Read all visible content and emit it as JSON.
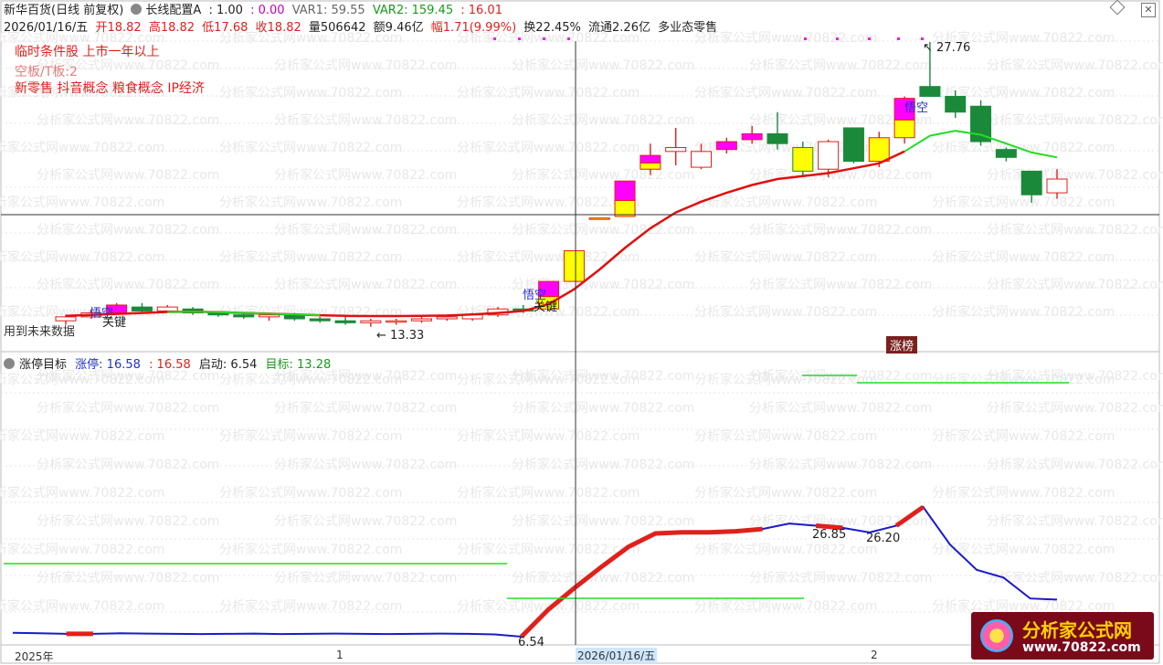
{
  "header": {
    "stock": "新华百货(日线 前复权)",
    "indicator": "长线配置A",
    "ind_val1": ": 1.00",
    "ind_val2": ": 0.00",
    "var1": "VAR1: 59.55",
    "var2": "VAR2: 159.45",
    "var3": ": 16.01",
    "date": "2026/01/16/五",
    "open": "开18.82",
    "high": "高18.82",
    "low": "低17.68",
    "close": "收18.82",
    "volume": "量506642",
    "amount": "额9.46亿",
    "change": "幅1.71(9.99%)",
    "turnover": "换22.45%",
    "float": "流通2.26亿",
    "sector": "多业态零售"
  },
  "notes": {
    "line1": "临时条件股 上市一年以上",
    "line2": "空板/T板:2",
    "line3": "新零售 抖音概念 粮食概念 IP经济"
  },
  "labels": {
    "future_data": "用到未来数据",
    "limit_list": "涨榜",
    "low_price": "13.33",
    "high_price": "27.76",
    "wukong": "悟空",
    "key": "关键"
  },
  "indicator_panel": {
    "title": "涨停目标",
    "zt_label": "涨停: 16.58",
    "zt_val": ": 16.58",
    "start_label": "启动: 6.54",
    "target_label": "目标: 13.28",
    "annot_1": "26.85",
    "annot_2": "26.20",
    "annot_3": "6.54"
  },
  "xaxis": {
    "year": "2025年",
    "m1": "1",
    "cursor_date": "2026/01/16/五",
    "m2": "2"
  },
  "watermark": "分析家公式网www.70822.com",
  "logo": {
    "title": "分析家公式网",
    "url": "www.70822.com"
  },
  "colors": {
    "up": "#e0201b",
    "down": "#1a8a3a",
    "magenta": "#ff00ff",
    "yellow": "#ffff00",
    "ma": "#e01010",
    "ma_green": "#22dd22",
    "blue_line": "#1a1acc"
  },
  "chart_data": [
    {
      "type": "candlestick",
      "candles": [
        {
          "o": 13.6,
          "h": 13.9,
          "l": 13.4,
          "c": 13.8,
          "mark": "normal"
        },
        {
          "o": 13.8,
          "h": 14.1,
          "l": 13.7,
          "c": 14.0,
          "mark": "normal"
        },
        {
          "o": 14.0,
          "h": 14.5,
          "l": 13.9,
          "c": 14.4,
          "mark": "magenta"
        },
        {
          "o": 14.3,
          "h": 14.5,
          "l": 14.0,
          "c": 14.1,
          "mark": "normal"
        },
        {
          "o": 14.1,
          "h": 14.4,
          "l": 14.0,
          "c": 14.3,
          "mark": "normal"
        },
        {
          "o": 14.2,
          "h": 14.3,
          "l": 13.9,
          "c": 14.0,
          "mark": "normal"
        },
        {
          "o": 14.0,
          "h": 14.1,
          "l": 13.8,
          "c": 13.9,
          "mark": "normal"
        },
        {
          "o": 13.9,
          "h": 14.0,
          "l": 13.7,
          "c": 13.8,
          "mark": "normal"
        },
        {
          "o": 13.8,
          "h": 14.0,
          "l": 13.6,
          "c": 13.9,
          "mark": "normal"
        },
        {
          "o": 13.9,
          "h": 14.0,
          "l": 13.6,
          "c": 13.7,
          "mark": "normal"
        },
        {
          "o": 13.7,
          "h": 13.8,
          "l": 13.5,
          "c": 13.6,
          "mark": "normal"
        },
        {
          "o": 13.6,
          "h": 13.8,
          "l": 13.4,
          "c": 13.5,
          "mark": "normal"
        },
        {
          "o": 13.5,
          "h": 13.7,
          "l": 13.3,
          "c": 13.6,
          "mark": "normal"
        },
        {
          "o": 13.6,
          "h": 13.7,
          "l": 13.4,
          "c": 13.6,
          "mark": "normal"
        },
        {
          "o": 13.6,
          "h": 13.8,
          "l": 13.5,
          "c": 13.7,
          "mark": "normal"
        },
        {
          "o": 13.7,
          "h": 13.9,
          "l": 13.6,
          "c": 13.8,
          "mark": "normal"
        },
        {
          "o": 13.7,
          "h": 14.0,
          "l": 13.6,
          "c": 13.9,
          "mark": "normal"
        },
        {
          "o": 13.9,
          "h": 14.3,
          "l": 13.8,
          "c": 14.2,
          "mark": "normal"
        },
        {
          "o": 14.2,
          "h": 14.4,
          "l": 14.0,
          "c": 14.1,
          "mark": "normal"
        },
        {
          "o": 14.2,
          "h": 15.6,
          "l": 14.2,
          "c": 15.6,
          "mark": "magenta"
        },
        {
          "o": 15.6,
          "h": 17.16,
          "l": 15.6,
          "c": 17.16,
          "mark": "yellow"
        },
        {
          "o": 18.8,
          "h": 18.82,
          "l": 18.8,
          "c": 18.82,
          "mark": "yellow"
        },
        {
          "o": 18.9,
          "h": 20.7,
          "l": 18.9,
          "c": 20.7,
          "mark": "magenta"
        },
        {
          "o": 21.3,
          "h": 22.6,
          "l": 21.0,
          "c": 22.0,
          "mark": "magenta"
        },
        {
          "o": 22.2,
          "h": 23.4,
          "l": 21.5,
          "c": 22.4,
          "mark": "normal"
        },
        {
          "o": 21.4,
          "h": 22.6,
          "l": 21.3,
          "c": 22.2,
          "mark": "normal"
        },
        {
          "o": 22.3,
          "h": 22.9,
          "l": 22.1,
          "c": 22.7,
          "mark": "magenta"
        },
        {
          "o": 22.8,
          "h": 23.5,
          "l": 22.6,
          "c": 23.1,
          "mark": "magenta"
        },
        {
          "o": 23.1,
          "h": 24.2,
          "l": 22.3,
          "c": 22.6,
          "mark": "normal"
        },
        {
          "o": 22.4,
          "h": 22.7,
          "l": 20.9,
          "c": 21.2,
          "mark": "yellow"
        },
        {
          "o": 21.3,
          "h": 22.8,
          "l": 20.9,
          "c": 22.7,
          "mark": "normal"
        },
        {
          "o": 23.4,
          "h": 23.4,
          "l": 21.6,
          "c": 21.7,
          "mark": "normal"
        },
        {
          "o": 21.7,
          "h": 23.2,
          "l": 21.4,
          "c": 22.9,
          "mark": "yellow"
        },
        {
          "o": 22.9,
          "h": 25.0,
          "l": 22.6,
          "c": 24.9,
          "mark": "magenta"
        },
        {
          "o": 25.5,
          "h": 27.76,
          "l": 25.0,
          "c": 25.0,
          "mark": "normal"
        },
        {
          "o": 25.0,
          "h": 25.3,
          "l": 23.9,
          "c": 24.2,
          "mark": "normal"
        },
        {
          "o": 24.5,
          "h": 24.8,
          "l": 22.5,
          "c": 22.7,
          "mark": "normal"
        },
        {
          "o": 22.3,
          "h": 22.4,
          "l": 21.7,
          "c": 21.9,
          "mark": "normal"
        },
        {
          "o": 21.2,
          "h": 21.2,
          "l": 19.6,
          "c": 20.0,
          "mark": "normal"
        },
        {
          "o": 20.1,
          "h": 21.3,
          "l": 19.8,
          "c": 20.8,
          "mark": "normal"
        }
      ],
      "ma": [
        13.85,
        13.9,
        13.95,
        14.0,
        14.05,
        14.06,
        14.04,
        14.0,
        13.96,
        13.92,
        13.88,
        13.85,
        13.84,
        13.84,
        13.85,
        13.87,
        13.92,
        14.0,
        14.1,
        14.45,
        15.2,
        16.2,
        17.3,
        18.3,
        19.1,
        19.65,
        20.1,
        20.5,
        20.8,
        20.95,
        21.1,
        21.35,
        21.6,
        22.2,
        23.0,
        23.25,
        23.05,
        22.6,
        22.15,
        21.9
      ]
    },
    {
      "type": "line",
      "series": [
        {
          "values": [
            6.9,
            6.85,
            6.8,
            6.8,
            6.85,
            6.82,
            6.8,
            6.78,
            6.8,
            6.82,
            6.78,
            6.8,
            6.82,
            6.8,
            6.78,
            6.8,
            6.82,
            6.8,
            6.75,
            6.54,
            9.0,
            11.0,
            12.9,
            14.7,
            15.9,
            16.0,
            16.0,
            16.1,
            16.3,
            16.8,
            16.6,
            16.4,
            16.0,
            16.6,
            18.3,
            14.9,
            12.6,
            11.9,
            10.0,
            9.9
          ]
        },
        {
          "values": [
            13.28,
            13.28,
            13.28,
            13.28,
            13.28,
            13.28,
            13.28,
            13.28,
            13.28,
            13.28,
            13.28,
            13.28,
            13.28,
            13.28,
            13.28,
            13.28,
            13.28,
            13.28,
            13.28,
            10.0,
            10.0,
            10.0,
            10.0,
            10.0,
            10.0,
            10.0,
            10.0,
            10.0,
            10.0,
            10.0,
            30.0,
            30.0,
            28.9,
            28.9,
            28.9,
            28.9,
            28.9,
            28.9,
            28.9,
            28.9
          ]
        }
      ]
    }
  ]
}
